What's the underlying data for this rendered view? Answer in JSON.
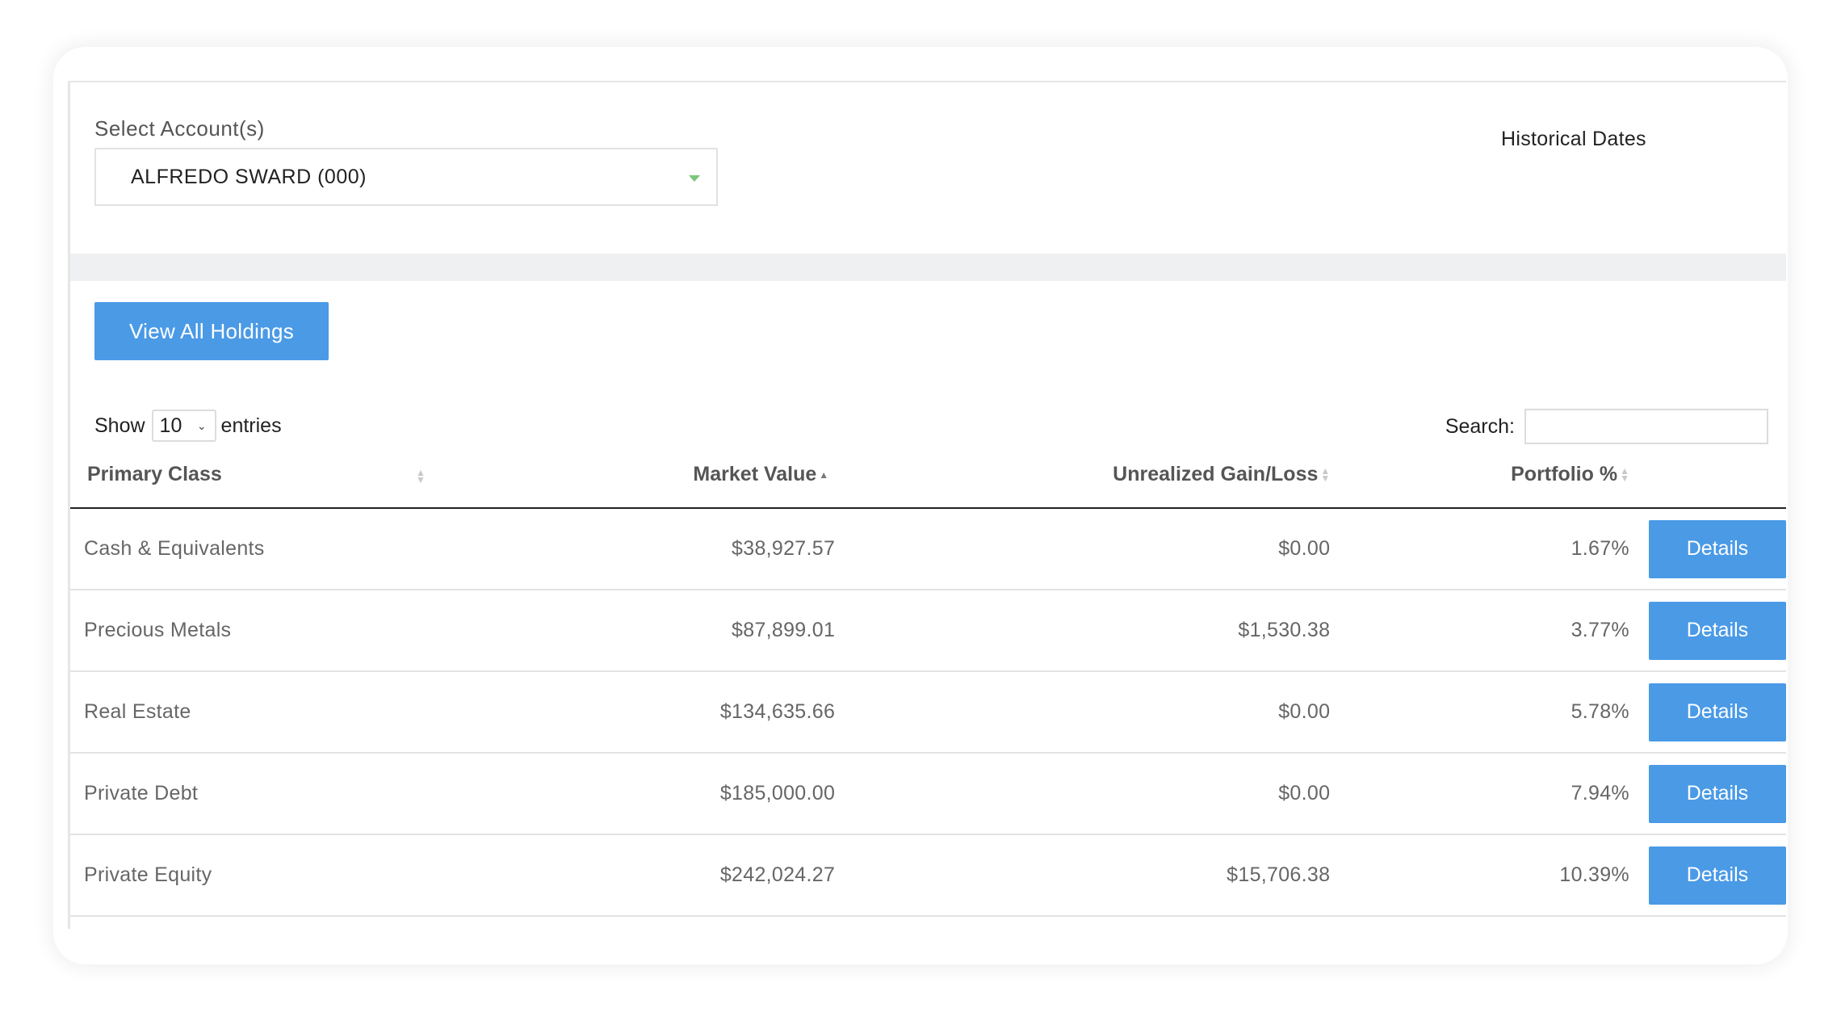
{
  "accounts": {
    "label": "Select Account(s)",
    "selected": "ALFREDO SWARD (000)"
  },
  "historical_dates_label": "Historical Dates",
  "view_all_holdings_label": "View All Holdings",
  "length_control": {
    "show_label": "Show",
    "value": "10",
    "entries_label": "entries"
  },
  "search": {
    "label": "Search:",
    "value": ""
  },
  "table": {
    "columns": [
      "Primary Class",
      "Market Value",
      "Unrealized Gain/Loss",
      "Portfolio %"
    ],
    "sorted_column": "Market Value",
    "sort_direction": "ascending",
    "action_label": "Details",
    "rows": [
      {
        "primary_class": "Cash & Equivalents",
        "market_value": "$38,927.57",
        "unrealized": "$0.00",
        "portfolio_pct": "1.67%"
      },
      {
        "primary_class": "Precious Metals",
        "market_value": "$87,899.01",
        "unrealized": "$1,530.38",
        "portfolio_pct": "3.77%"
      },
      {
        "primary_class": "Real Estate",
        "market_value": "$134,635.66",
        "unrealized": "$0.00",
        "portfolio_pct": "5.78%"
      },
      {
        "primary_class": "Private Debt",
        "market_value": "$185,000.00",
        "unrealized": "$0.00",
        "portfolio_pct": "7.94%"
      },
      {
        "primary_class": "Private Equity",
        "market_value": "$242,024.27",
        "unrealized": "$15,706.38",
        "portfolio_pct": "10.39%"
      }
    ]
  },
  "colors": {
    "button": "#4a9ae6",
    "dropdown_caret": "#7bc67b",
    "band": "#eef0f2"
  },
  "icons": [
    "dropdown-caret-icon",
    "chevron-down-icon",
    "sort-icon",
    "sort-ascending-icon"
  ]
}
